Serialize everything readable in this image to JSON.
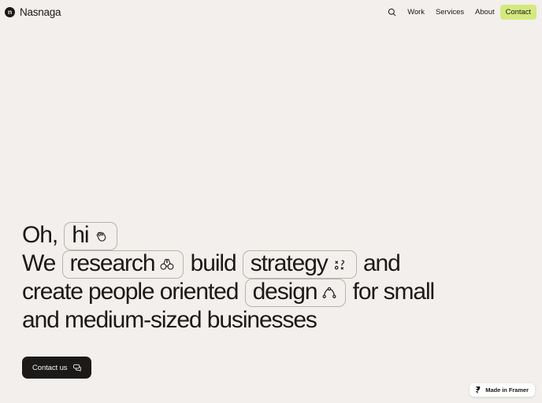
{
  "header": {
    "brand": {
      "mark_letter": "n",
      "name": "Nasnaga"
    },
    "search_icon": "search-icon",
    "nav_items": [
      {
        "label": "Work",
        "accent": false
      },
      {
        "label": "Services",
        "accent": false
      },
      {
        "label": "About",
        "accent": false
      },
      {
        "label": "Contact",
        "accent": true
      }
    ],
    "accent_color": "#d4e97f"
  },
  "hero": {
    "line1": {
      "prefix": "Oh, ",
      "pill": {
        "text": "hi",
        "icon": "waving-hand-icon"
      },
      "suffix": ""
    },
    "line2": {
      "prefix": "We ",
      "pill1": {
        "text": "research",
        "icon": "binoculars-icon"
      },
      "middle": " build ",
      "pill2": {
        "text": "strategy",
        "icon": "strategy-playbook-icon"
      },
      "suffix": " and"
    },
    "line3": {
      "prefix": "create people oriented ",
      "pill": {
        "text": "design",
        "icon": "bezier-curve-icon"
      },
      "suffix": " for small"
    },
    "line4": {
      "text": "and medium-sized businesses"
    }
  },
  "cta": {
    "label": "Contact us",
    "icon": "chat-bubbles-icon"
  },
  "framer_badge": {
    "label": "Made in Framer",
    "icon": "framer-logo-icon"
  },
  "colors": {
    "background": "#f2efec",
    "text": "#1c1a19",
    "accent": "#d4e97f",
    "pill_border": "#b9b4ae",
    "cta_background": "#1c1a19"
  }
}
